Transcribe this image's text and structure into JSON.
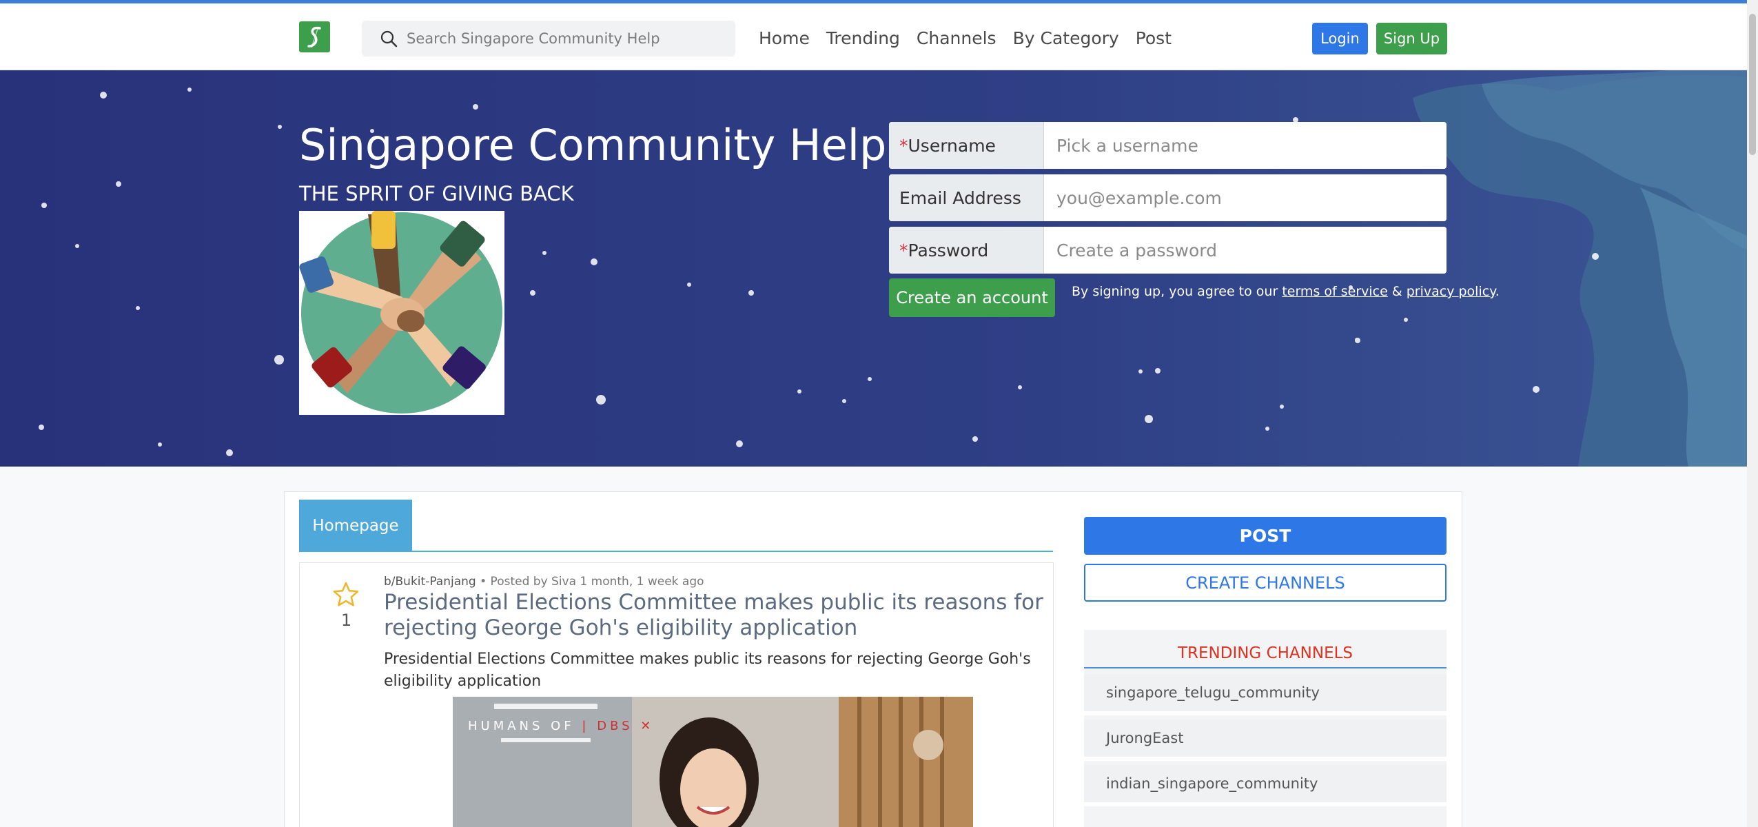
{
  "header": {
    "search_placeholder": "Search Singapore Community Help",
    "nav": [
      "Home",
      "Trending",
      "Channels",
      "By Category",
      "Post"
    ],
    "login": "Login",
    "signup": "Sign Up"
  },
  "hero": {
    "title": "Singapore Community Help",
    "subtitle": "THE SPRIT OF GIVING BACK"
  },
  "signup_form": {
    "req": "*",
    "username_label": "Username",
    "username_placeholder": "Pick a username",
    "email_label": "Email Address",
    "email_placeholder": "you@example.com",
    "password_label": "Password",
    "password_placeholder": "Create a password",
    "submit": "Create an account",
    "terms_prefix": "By signing up, you agree to our",
    "terms_link": "terms of service",
    "terms_and": "&",
    "privacy_link": "privacy policy",
    "terms_suffix": "."
  },
  "tabs": {
    "homepage": "Homepage"
  },
  "post": {
    "channel": "b/Bukit-Panjang",
    "meta": "• Posted by Siva 1 month, 1 week ago",
    "votes": "1",
    "title": "Presidential Elections Committee makes public its reasons for rejecting George Goh's eligibility application",
    "body": "Presidential Elections Committee makes public its reasons for rejecting George Goh's eligibility application",
    "image_caption_left": "HUMANS OF",
    "image_caption_right": "DBS",
    "image_caption_mark": "✕"
  },
  "sidebar": {
    "post_button": "POST",
    "create_channels_button": "CREATE CHANNELS",
    "trending_title": "TRENDING CHANNELS",
    "trending": [
      "singapore_telugu_community",
      "JurongEast",
      "indian_singapore_community"
    ]
  },
  "colors": {
    "primary": "#2e77e6",
    "success": "#3d9e4b",
    "hero_bg": "#2b3a7a",
    "accent_red": "#e0301e"
  }
}
